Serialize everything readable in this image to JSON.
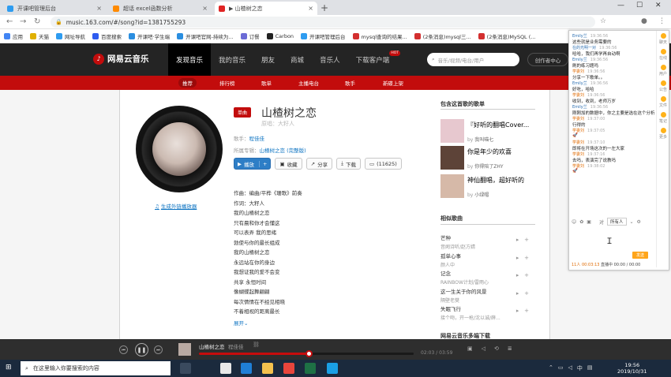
{
  "browser": {
    "tabs": [
      {
        "label": "开课吧管理后台",
        "color": "#2e9cf0",
        "active": false
      },
      {
        "label": "超话 excel函数分析",
        "color": "#ff8a00",
        "active": false
      },
      {
        "label": "▶ 山楂树之恋",
        "color": "#e02424",
        "active": true
      }
    ],
    "new_tab": "+",
    "url": "music.163.com/#/song?id=1381755293",
    "bookmarks": [
      {
        "label": "应用",
        "color": "#4285f4"
      },
      {
        "label": "天猫",
        "color": "#e0b000"
      },
      {
        "label": "网址导航",
        "color": "#2e9cf0"
      },
      {
        "label": "百度搜索",
        "color": "#2e5cf0"
      },
      {
        "label": "开课吧·学生端",
        "color": "#2a8ee0"
      },
      {
        "label": "开课吧官网-持续为...",
        "color": "#2a8ee0"
      },
      {
        "label": "订餐",
        "color": "#6b6bd6"
      },
      {
        "label": "Carbon",
        "color": "#222222"
      },
      {
        "label": "开课吧管理后台",
        "color": "#2e9cf0"
      },
      {
        "label": "mysql查询的结果...",
        "color": "#d32f2f"
      },
      {
        "label": "(2条消息)mysql三...",
        "color": "#d32f2f"
      },
      {
        "label": "(2条消息)MySQL (...",
        "color": "#d32f2f"
      }
    ]
  },
  "netease": {
    "logo": "网易云音乐",
    "nav": [
      "发现音乐",
      "我的音乐",
      "朋友",
      "商城",
      "音乐人",
      "下载客户端"
    ],
    "hot": "HOT",
    "search_placeholder": "音乐/视频/电台/用户",
    "creator": "创作者中心",
    "login": "登录",
    "subnav": [
      "推荐",
      "排行榜",
      "歌单",
      "主播电台",
      "歌手",
      "新碟上架"
    ]
  },
  "song": {
    "tag": "单曲",
    "title": "山楂树之恋",
    "subtitle": "原唱：大籽人",
    "singer_label": "歌手：",
    "singer": "程佳佳",
    "album_label": "所属专辑：",
    "album": "山楂树之恋 (完整版)",
    "buttons": {
      "play": "播放",
      "plus": "+",
      "collect": "收藏",
      "share": "分享",
      "download": "下载",
      "comment": "(11625)"
    },
    "external": "生成外链播放器",
    "lyrics": [
      "作曲：编曲/平桦《珊歌》前奏",
      "作词：大籽人",
      "我的山楂树之恋",
      "只有晨和你才会懂这",
      "可以表弄 我的思绪",
      "勃使与你的最长组成",
      "我的山楂树之恋",
      "永远站在你的身边",
      "我想证我的爱不会变",
      "共享 永恒时间",
      "像蝴蝶起舞翩翩",
      "每次情情在不经见相晓",
      "不着相视的距离最长"
    ],
    "expand": "展开"
  },
  "sidebar": {
    "playlists_header": "包含这首歌的歌单",
    "playlists": [
      {
        "name": "『好听的翻唱Cover...",
        "by": "by",
        "user": "我叫喵七",
        "color": "#e7c8cf"
      },
      {
        "name": "你是年少的欢喜",
        "by": "by",
        "user": "你得陪了ZHY",
        "color": "#5d4338"
      },
      {
        "name": "神仙翻唱，超好听的",
        "by": "by",
        "user": "小绿帽",
        "color": "#d6b9a8"
      }
    ],
    "similar_header": "相似歌曲",
    "similar": [
      {
        "title": "芒种",
        "artist": "音阙诗听/赵方婧"
      },
      {
        "title": "孤单心事",
        "artist": "颜人中"
      },
      {
        "title": "记念",
        "artist": "RAINBOW计划/雷雨心"
      },
      {
        "title": "这一生关于你的风景",
        "artist": "隔壁老樊"
      },
      {
        "title": "失眠飞行",
        "artist": "接个吻，开一枪/沈以诚/薛..."
      }
    ],
    "footer_header": "网易云音乐多端下载"
  },
  "player": {
    "title": "山楂树之恋",
    "artist": "程佳佳",
    "time": "02:03 / 03:59",
    "progress": 0.51
  },
  "chat": {
    "messages": [
      {
        "name": "Emily兰",
        "time": "19:36:56",
        "text": "这些就是业务需要的",
        "own": false
      },
      {
        "name": "在的光明一对",
        "time": "19:36:56",
        "text": "哈哈，我们再学再自动啊",
        "own": false
      },
      {
        "name": "Emily兰",
        "time": "19:36:56",
        "text": "刷的练习题吗",
        "own": false
      },
      {
        "name": "学委刘",
        "time": "19:36:56",
        "text": "分享一下歌单。。",
        "own": true
      },
      {
        "name": "Emily兰",
        "time": "19:36:56",
        "text": "好吃，哈哈",
        "own": false
      },
      {
        "name": "学委刘",
        "time": "19:36:56",
        "text": "收到，收到，老师万岁",
        "own": true
      },
      {
        "name": "Emily兰",
        "time": "19:36:56",
        "text": "刚刚加的数据中，你之主要是选在这个分析",
        "own": false
      },
      {
        "name": "学委刘",
        "time": "19:37:00",
        "text": "行得的",
        "own": true
      },
      {
        "name": "学委刘",
        "time": "19:37:05",
        "text": "🚀",
        "own": true
      },
      {
        "name": "学委刘",
        "time": "19:37:10",
        "text": "即将在开场这次的一左大家",
        "own": true
      },
      {
        "name": "学委刘",
        "time": "19:37:16",
        "text": "去吗，表演完了说教吗",
        "own": true
      },
      {
        "name": "学委刘",
        "time": "19:38:02",
        "text": "🚀",
        "own": true
      }
    ],
    "side": [
      "聊天",
      "在线",
      "用户",
      "公告",
      "文件",
      "笔记",
      "更多"
    ],
    "target": "所有人",
    "send": "发送",
    "footer_count": "11人",
    "footer_time": "00:03:13",
    "footer_rest": "直播中 00:00 / 00:00"
  },
  "taskbar": {
    "search_placeholder": "在这里输入你要搜索的内容",
    "time": "19:56",
    "date": "2019/10/31",
    "apps": [
      {
        "name": "task-view",
        "color": "#3a4a5e"
      },
      {
        "name": "mail",
        "color": "#e8e8e8"
      },
      {
        "name": "edge",
        "color": "#1f7fd6"
      },
      {
        "name": "explorer",
        "color": "#f2c14e"
      },
      {
        "name": "chrome",
        "color": "#e8453c"
      },
      {
        "name": "excel",
        "color": "#1e7145"
      },
      {
        "name": "meeting",
        "color": "#1aa0e6"
      }
    ]
  }
}
